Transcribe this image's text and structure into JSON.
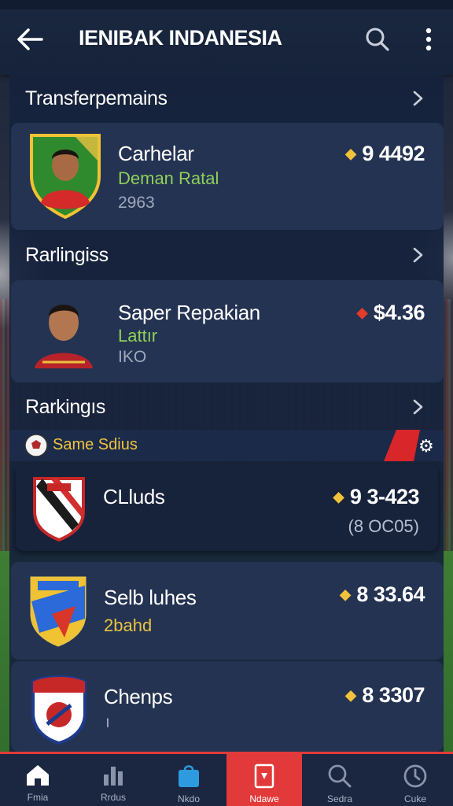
{
  "header": {
    "title": "IENIBAK INDANESIA"
  },
  "sections": [
    {
      "title": "Transferpemains"
    },
    {
      "title": "Rarlingiss"
    },
    {
      "title": "Rarkingıs"
    }
  ],
  "transfer_card": {
    "name": "Carhelar",
    "subtitle": "Deman Ratal",
    "meta": "2963",
    "price": "9 4492"
  },
  "ranking_card": {
    "name": "Saper Repakian",
    "subtitle": "Lattır",
    "meta": "IKO",
    "price": "$4.36"
  },
  "promo": {
    "label": "Same Sdius"
  },
  "clubs": [
    {
      "name": "CLluds",
      "price": "9 3-423",
      "sub": "(8 OC05)"
    },
    {
      "name": "Selb luhes",
      "price": "8 33.64",
      "sub": "2bahd"
    },
    {
      "name": "Chenps",
      "price": "8 3307",
      "sub": "ı"
    }
  ],
  "nav": [
    {
      "label": "Fmia",
      "icon": "home-icon"
    },
    {
      "label": "Rrdus",
      "icon": "stats-icon"
    },
    {
      "label": "Nkdo",
      "icon": "bag-icon"
    },
    {
      "label": "Ndawe",
      "icon": "card-icon"
    },
    {
      "label": "Sedra",
      "icon": "search-icon"
    },
    {
      "label": "Cuke",
      "icon": "clock-icon"
    }
  ],
  "colors": {
    "accent": "#e23a3a",
    "panel": "#16223c",
    "coin": "#f2c23a",
    "highlight": "#e9c340"
  }
}
